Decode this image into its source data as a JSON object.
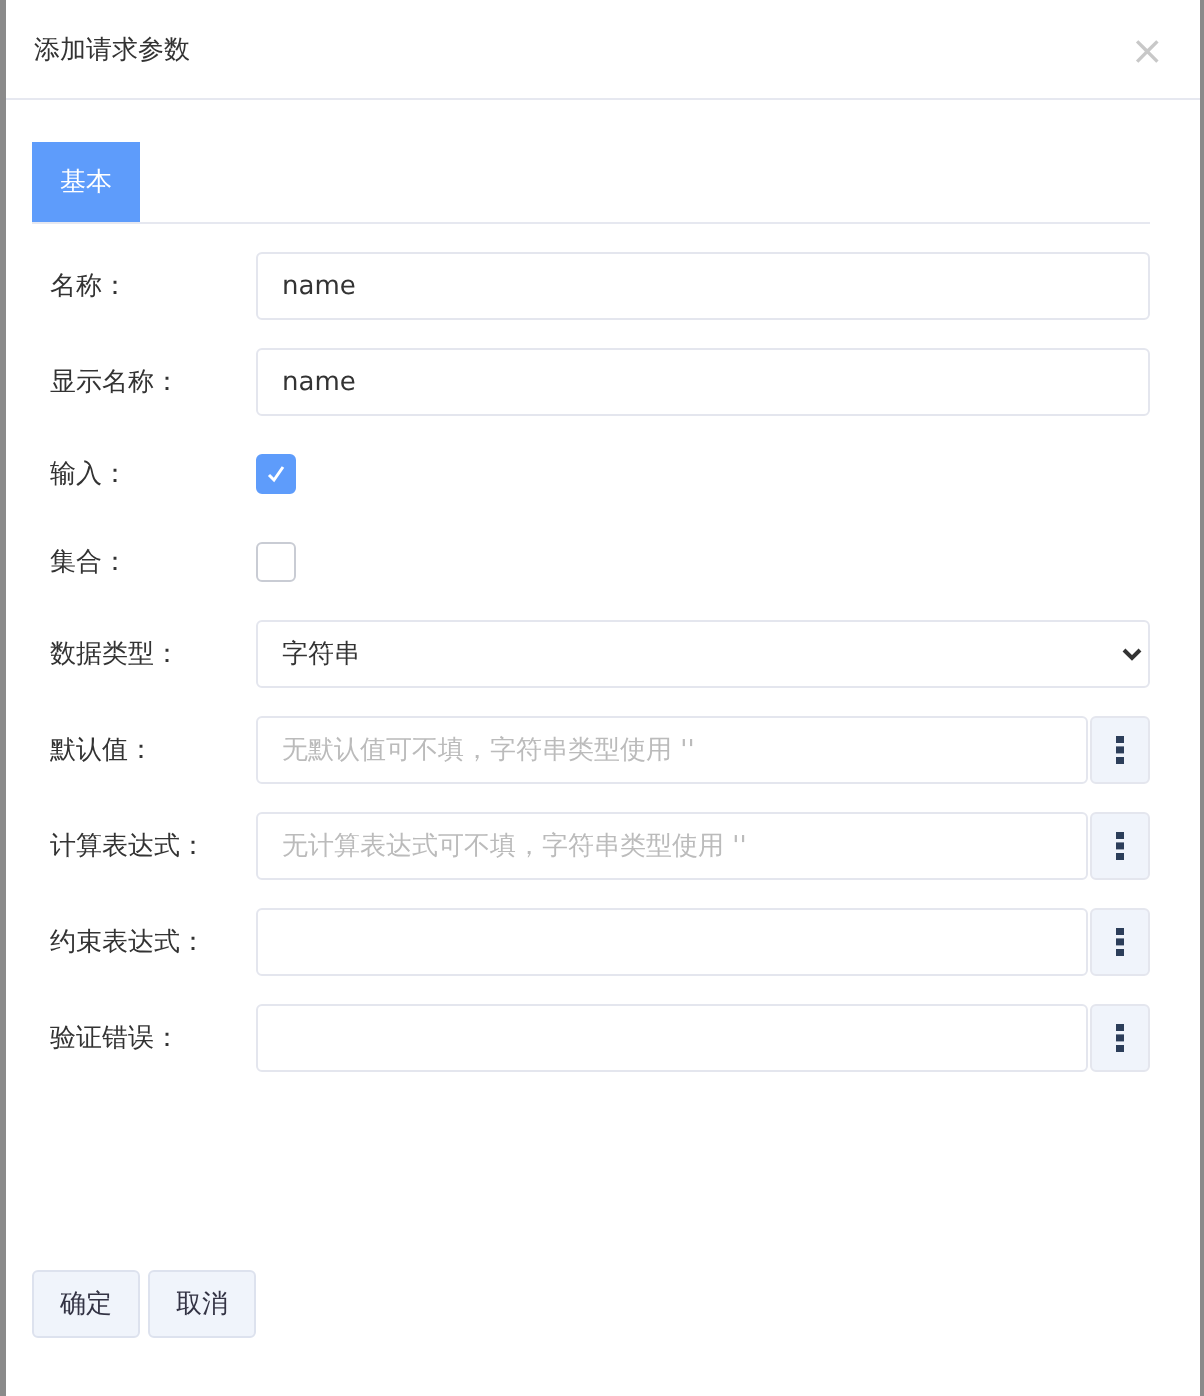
{
  "dialog": {
    "title": "添加请求参数",
    "close": "×"
  },
  "tabs": [
    {
      "label": "基本",
      "selected": true
    }
  ],
  "fields": [
    {
      "kind": "text",
      "label": "名称：",
      "value": "name"
    },
    {
      "kind": "text",
      "label": "显示名称：",
      "value": "name"
    },
    {
      "kind": "checkbox",
      "label": "输入：",
      "checked": true
    },
    {
      "kind": "checkbox",
      "label": "集合：",
      "checked": false
    },
    {
      "kind": "select",
      "label": "数据类型：",
      "value": "字符串"
    },
    {
      "kind": "menu",
      "label": "默认值：",
      "placeholder": "无默认值可不填，字符串类型使用 ''"
    },
    {
      "kind": "menu",
      "label": "计算表达式：",
      "placeholder": "无计算表达式可不填，字符串类型使用 ''"
    },
    {
      "kind": "menu",
      "label": "约束表达式："
    },
    {
      "kind": "menu",
      "label": "验证错误："
    }
  ],
  "buttons": [
    "确定",
    "取消"
  ]
}
